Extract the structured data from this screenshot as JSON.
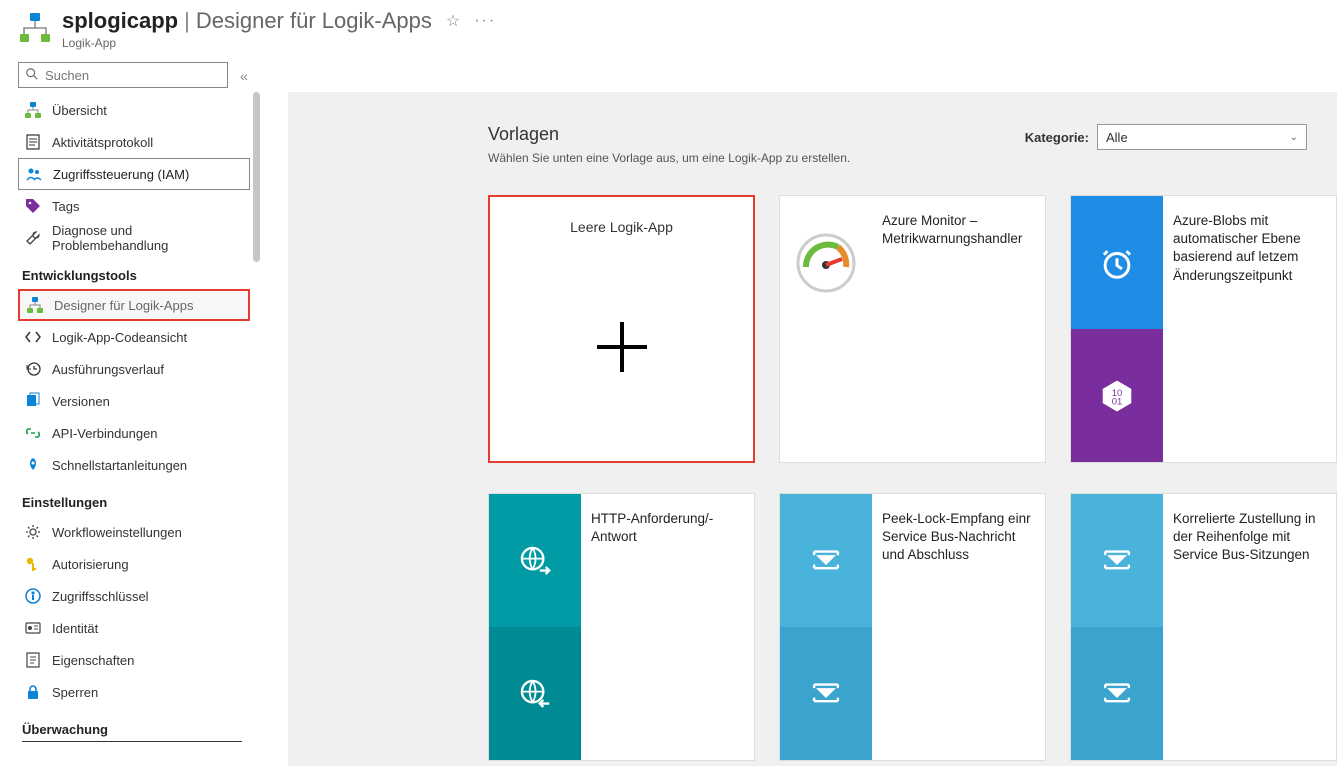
{
  "header": {
    "title_strong": "splogicapp",
    "title_sep": "|",
    "title_light": "Designer für Logik-Apps",
    "subtitle": "Logik-App"
  },
  "search": {
    "placeholder": "Suchen"
  },
  "sidebar": {
    "top_items": [
      {
        "id": "overview",
        "label": "Übersicht",
        "icon": "hierarchy-icon",
        "state": ""
      },
      {
        "id": "activitylog",
        "label": "Aktivitätsprotokoll",
        "icon": "log-icon",
        "state": ""
      },
      {
        "id": "iam",
        "label": "Zugriffssteuerung (IAM)",
        "icon": "people-icon",
        "state": "selected-outline"
      },
      {
        "id": "tags",
        "label": "Tags",
        "icon": "tag-icon",
        "state": ""
      },
      {
        "id": "diagnose",
        "label": "Diagnose und Problembehandlung",
        "icon": "wrench-icon",
        "state": ""
      }
    ],
    "sections": [
      {
        "header": "Entwicklungstools",
        "items": [
          {
            "id": "designer",
            "label": "Designer für Logik-Apps",
            "icon": "hierarchy-icon",
            "state": "highlighted-red"
          },
          {
            "id": "codeview",
            "label": "Logik-App-Codeansicht",
            "icon": "code-icon",
            "state": ""
          },
          {
            "id": "runhistory",
            "label": "Ausführungsverlauf",
            "icon": "history-icon",
            "state": ""
          },
          {
            "id": "versions",
            "label": "Versionen",
            "icon": "versions-icon",
            "state": ""
          },
          {
            "id": "apiconn",
            "label": "API-Verbindungen",
            "icon": "link-icon",
            "state": ""
          },
          {
            "id": "quickstart",
            "label": "Schnellstartanleitungen",
            "icon": "rocket-icon",
            "state": ""
          }
        ]
      },
      {
        "header": "Einstellungen",
        "items": [
          {
            "id": "workflow",
            "label": "Workfloweinstellungen",
            "icon": "gear-icon",
            "state": ""
          },
          {
            "id": "auth",
            "label": "Autorisierung",
            "icon": "key-icon",
            "state": ""
          },
          {
            "id": "accesskeys",
            "label": "Zugriffsschlüssel",
            "icon": "keys-icon",
            "state": ""
          },
          {
            "id": "identity",
            "label": "Identität",
            "icon": "identity-icon",
            "state": ""
          },
          {
            "id": "properties",
            "label": "Eigenschaften",
            "icon": "properties-icon",
            "state": ""
          },
          {
            "id": "locks",
            "label": "Sperren",
            "icon": "lock-icon",
            "state": ""
          }
        ]
      },
      {
        "header": "Überwachung",
        "underlined": true,
        "items": []
      }
    ]
  },
  "content": {
    "templates_title": "Vorlagen",
    "templates_sub": "Wählen Sie unten eine Vorlage aus, um eine Logik-App zu erstellen.",
    "category_label": "Kategorie:",
    "category_value": "Alle",
    "cards_row1": [
      {
        "id": "blank",
        "label": "Leere Logik-App",
        "kind": "blank",
        "outline": "red"
      },
      {
        "id": "azmonitor",
        "label": "Azure Monitor – Metrikwarnungshandler",
        "kind": "gauge"
      },
      {
        "id": "azblobs",
        "label": "Azure-Blobs mit automatischer Ebene basierend auf letzem Änderungszeitpunkt",
        "kind": "alarm-data"
      }
    ],
    "cards_row2": [
      {
        "id": "httpreq",
        "label": "HTTP-Anforderung/-Antwort",
        "kind": "http"
      },
      {
        "id": "peeklock",
        "label": "Peek-Lock-Empfang einr Service Bus-Nachricht und Abschluss",
        "kind": "servicebus"
      },
      {
        "id": "correlated",
        "label": "Korrelierte Zustellung in der Reihenfolge mit Service Bus-Sitzungen",
        "kind": "servicebus"
      }
    ]
  }
}
